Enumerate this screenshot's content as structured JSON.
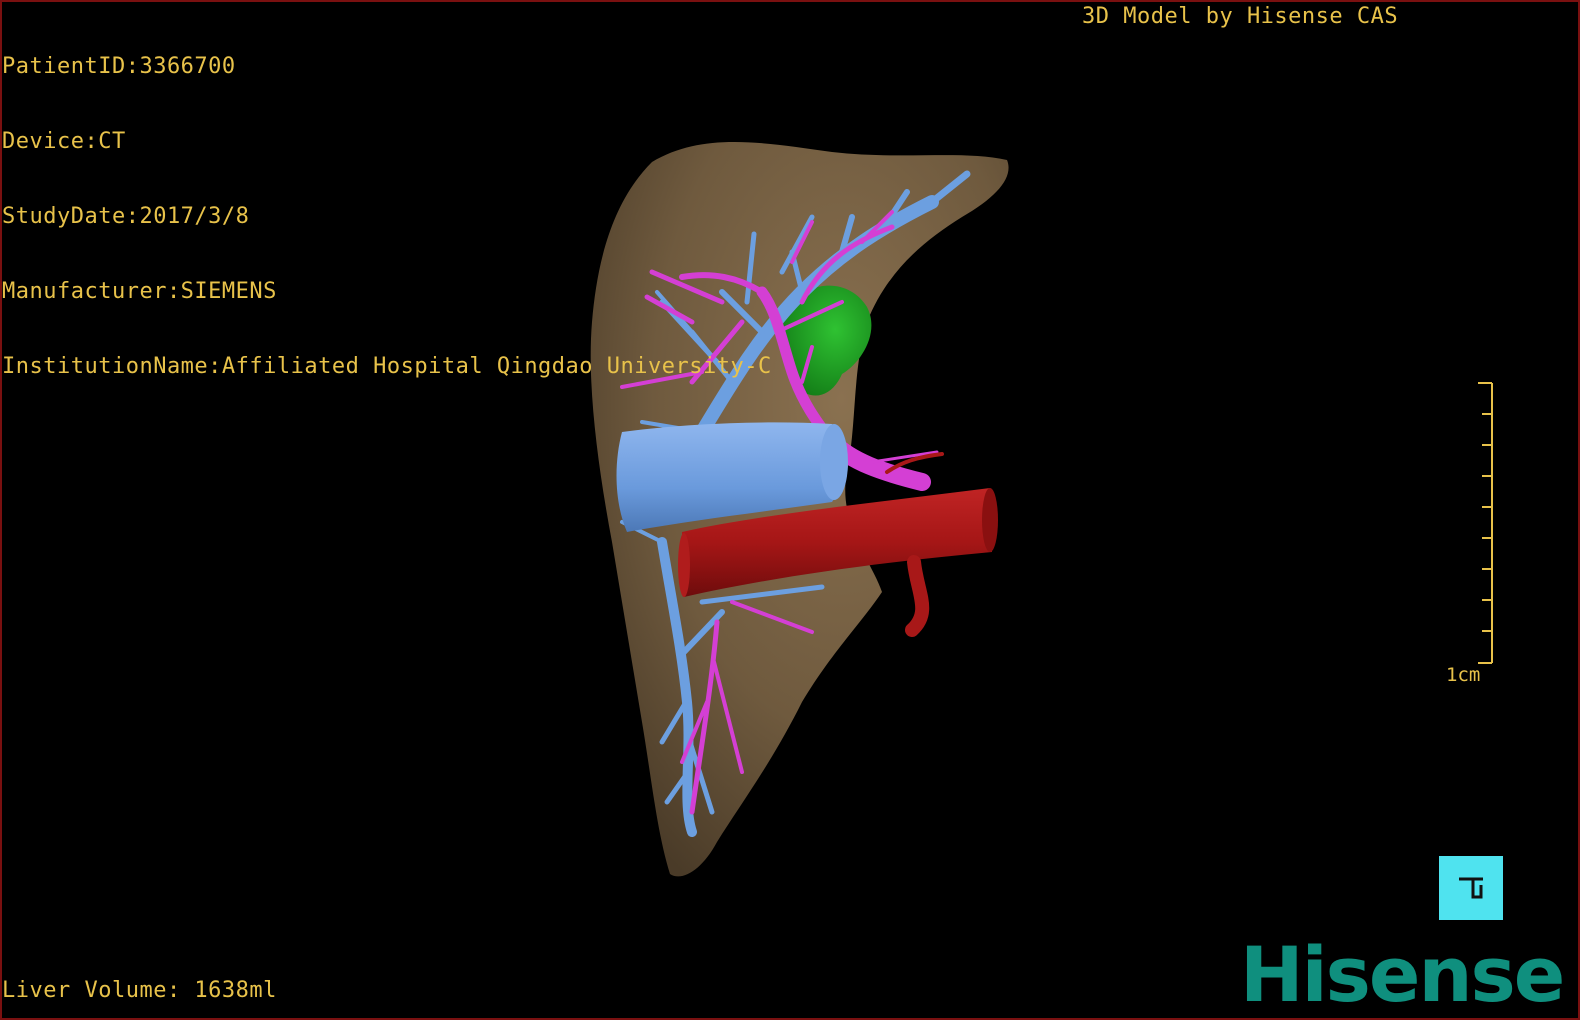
{
  "overlay": {
    "patient_id": "PatientID:3366700",
    "device": "Device:CT",
    "study_date": "StudyDate:2017/3/8",
    "manufacturer": "Manufacturer:SIEMENS",
    "institution": "InstitutionName:Affiliated Hospital Qingdao University-C",
    "brand_title": "3D Model by Hisense CAS",
    "liver_volume": "Liver Volume: 1638ml"
  },
  "scale": {
    "label": "1cm"
  },
  "logo": {
    "text": "Hisense"
  },
  "view_cube": {
    "icon": "posterior-face-icon"
  },
  "colors": {
    "background": "#000000",
    "overlay_text": "#e8c24a",
    "liver": "#7a6446",
    "portal_vein": "#6c9fe0",
    "hepatic_artery": "#d43fd4",
    "aorta": "#a81818",
    "tumor": "#1c9e22",
    "view_cube": "#4fe3ef",
    "logo": "#0f8f7e",
    "frame": "#7a1010"
  }
}
